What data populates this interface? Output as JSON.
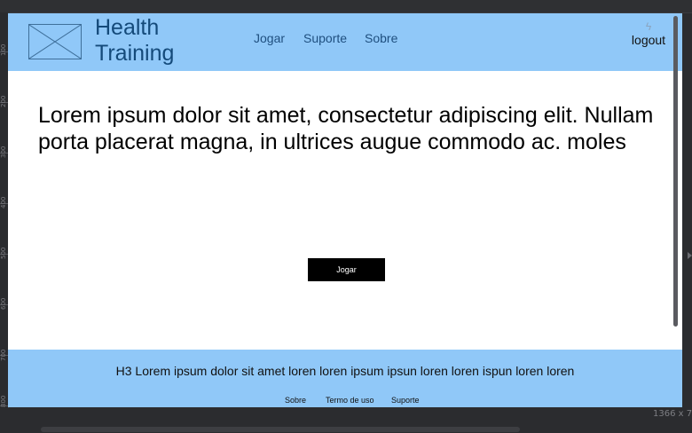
{
  "header": {
    "brand_line1": "Health",
    "brand_line2": "Training",
    "nav": [
      "Jogar",
      "Suporte",
      "Sobre"
    ],
    "logout_icon": "lightning-bolt-icon",
    "logout_label": "logout"
  },
  "main": {
    "text": "Lorem ipsum dolor sit amet, consectetur adipiscing elit. Nullam porta placerat magna, in ultrices augue commodo ac. moles",
    "button_label": "Jogar"
  },
  "footer": {
    "h3": "H3 Lorem ipsum dolor sit amet loren loren ipsum ipsun loren loren ispun loren loren",
    "links": [
      "Sobre",
      "Termo de uso",
      "Suporte"
    ]
  },
  "editor": {
    "ruler_labels": [
      "100",
      "200",
      "300",
      "400",
      "500",
      "600",
      "700",
      "800"
    ],
    "canvas_size_label": "1366 x 7"
  },
  "colors": {
    "header_bg": "#90c8f8",
    "brand": "#144a7a",
    "button_bg": "#000000"
  }
}
